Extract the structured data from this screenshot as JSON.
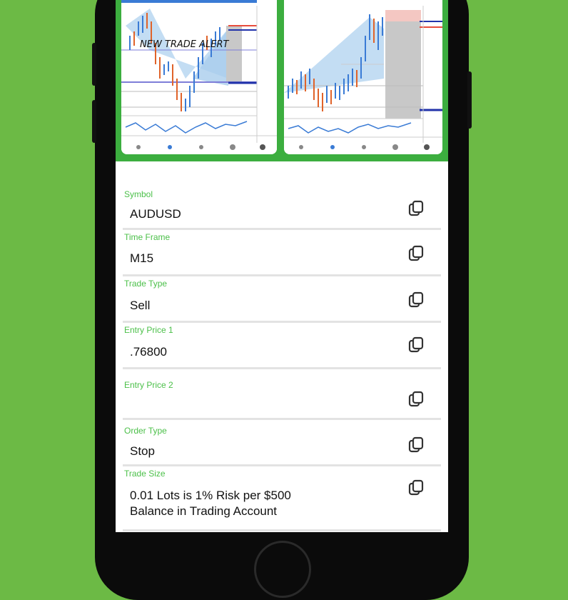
{
  "charts": {
    "left_annotation": "NEW TRADE ALERT"
  },
  "fields": [
    {
      "label": "Symbol",
      "value": "AUDUSD"
    },
    {
      "label": "Time Frame",
      "value": "M15"
    },
    {
      "label": "Trade Type",
      "value": "Sell"
    },
    {
      "label": "Entry Price 1",
      "value": ".76800"
    },
    {
      "label": "Entry Price 2",
      "value": ""
    },
    {
      "label": "Order Type",
      "value": "Stop"
    },
    {
      "label": "Trade Size",
      "value": "0.01 Lots is 1% Risk per $500 Balance in Trading Account"
    }
  ],
  "icons": {
    "copy": "copy-icon",
    "home": "home-button"
  },
  "colors": {
    "background": "#6cba45",
    "label_green": "#4cc04a",
    "chart_frame_green": "#3cae3f",
    "bull_candle": "#3a7bd5",
    "bear_candle": "#e0632a"
  }
}
